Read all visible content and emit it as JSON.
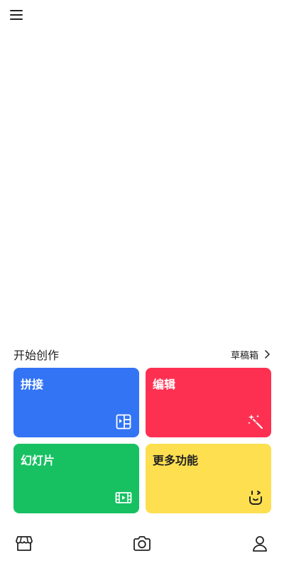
{
  "header": {
    "menu_icon": "menu-icon"
  },
  "section": {
    "title": "开始创作",
    "drafts_label": "草稿箱",
    "drafts_icon": "chevron-right-icon"
  },
  "cards": [
    {
      "label": "拼接",
      "color": "#3374f5",
      "text_color": "#ffffff",
      "icon": "film-frame-icon"
    },
    {
      "label": "编辑",
      "color": "#fe3052",
      "text_color": "#ffffff",
      "icon": "magic-wand-icon"
    },
    {
      "label": "幻灯片",
      "color": "#17c162",
      "text_color": "#ffffff",
      "icon": "film-strip-icon"
    },
    {
      "label": "更多功能",
      "color": "#fddf50",
      "text_color": "#222222",
      "icon": "smiley-icon"
    }
  ],
  "bottom_nav": {
    "items": [
      {
        "icon": "store-icon"
      },
      {
        "icon": "camera-icon"
      },
      {
        "icon": "profile-icon"
      }
    ]
  }
}
